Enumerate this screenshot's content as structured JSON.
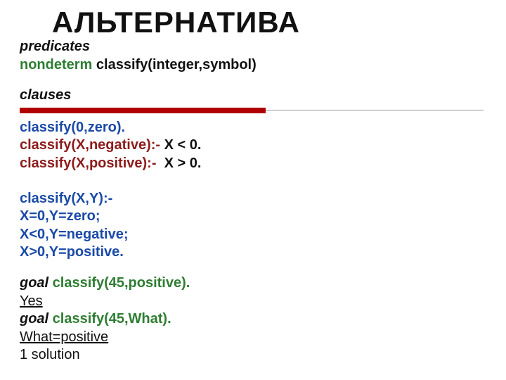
{
  "title": "АЛЬТЕРНАТИВА",
  "l1a": "predicates",
  "l2a": "nondeterm",
  "l2b": " classify(integer,symbol)",
  "l3a": "clauses",
  "l4a": "classify(0,zero).",
  "l5a": "classify(X,negative):-",
  "l5b": " X < 0.",
  "l6a": "classify(X,positive):-",
  "l6b": "  X > 0.",
  "l7": "classify(X,Y):-",
  "l8": "X=0,Y=zero;",
  "l9": "X<0,Y=negative;",
  "l10": "X>0,Y=positive.",
  "l11a": "goal",
  "l11b": " classify(45,positive).",
  "l12": "Yes",
  "l13a": "goal",
  "l13b": " classify(45,What).",
  "l14": "What=positive",
  "l15": "1 solution"
}
